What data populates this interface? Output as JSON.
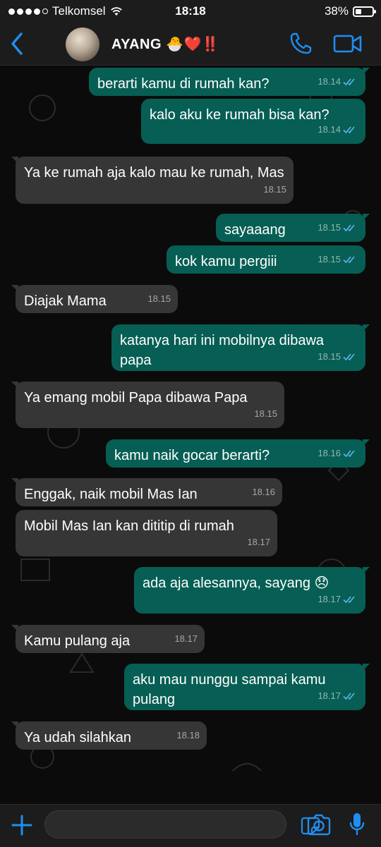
{
  "status": {
    "carrier": "Telkomsel",
    "time": "18:18",
    "battery": "38%",
    "battery_level": 0.38,
    "signal_bars_filled": 4,
    "signal_bars_total": 5
  },
  "header": {
    "back_icon": "chevron-left-icon",
    "contact_name": "AYANG 🐣❤️‼️",
    "call_icon": "phone-icon",
    "video_icon": "video-camera-icon"
  },
  "messages": [
    {
      "dir": "out",
      "text": "berarti kamu di rumah kan?",
      "time": "18.14",
      "read": true
    },
    {
      "dir": "out",
      "text": "kalo aku ke rumah bisa kan?",
      "time": "18.14",
      "read": true
    },
    {
      "dir": "in",
      "text": "Ya ke rumah aja kalo mau ke rumah, Mas",
      "time": "18.15"
    },
    {
      "dir": "out",
      "text": "sayaaang",
      "time": "18.15",
      "read": true
    },
    {
      "dir": "out",
      "text": "kok kamu pergiii",
      "time": "18.15",
      "read": true
    },
    {
      "dir": "in",
      "text": "Diajak Mama",
      "time": "18.15"
    },
    {
      "dir": "out",
      "text": "katanya hari ini mobilnya dibawa papa",
      "time": "18.15",
      "read": true
    },
    {
      "dir": "in",
      "text": "Ya emang mobil Papa dibawa Papa",
      "time": "18.15"
    },
    {
      "dir": "out",
      "text": "kamu naik gocar berarti?",
      "time": "18.16",
      "read": true
    },
    {
      "dir": "in",
      "text": "Enggak, naik mobil Mas Ian",
      "time": "18.16"
    },
    {
      "dir": "in",
      "text": "Mobil Mas Ian kan dititip di rumah",
      "time": "18.17"
    },
    {
      "dir": "out",
      "text": "ada aja alesannya, sayang 😞",
      "time": "18.17",
      "read": true
    },
    {
      "dir": "in",
      "text": "Kamu pulang aja",
      "time": "18.17"
    },
    {
      "dir": "out",
      "text": "aku mau nunggu sampai kamu pulang",
      "time": "18.17",
      "read": true
    },
    {
      "dir": "in",
      "text": "Ya udah silahkan",
      "time": "18.18"
    }
  ],
  "input_bar": {
    "plus_icon": "plus-icon",
    "sticker_icon": "sticker-icon",
    "camera_icon": "camera-icon",
    "mic_icon": "microphone-icon"
  },
  "colors": {
    "outgoing_bubble": "#075e54",
    "incoming_bubble": "#363636",
    "accent": "#1f8ef1",
    "read_ticks": "#5fb3f0"
  }
}
